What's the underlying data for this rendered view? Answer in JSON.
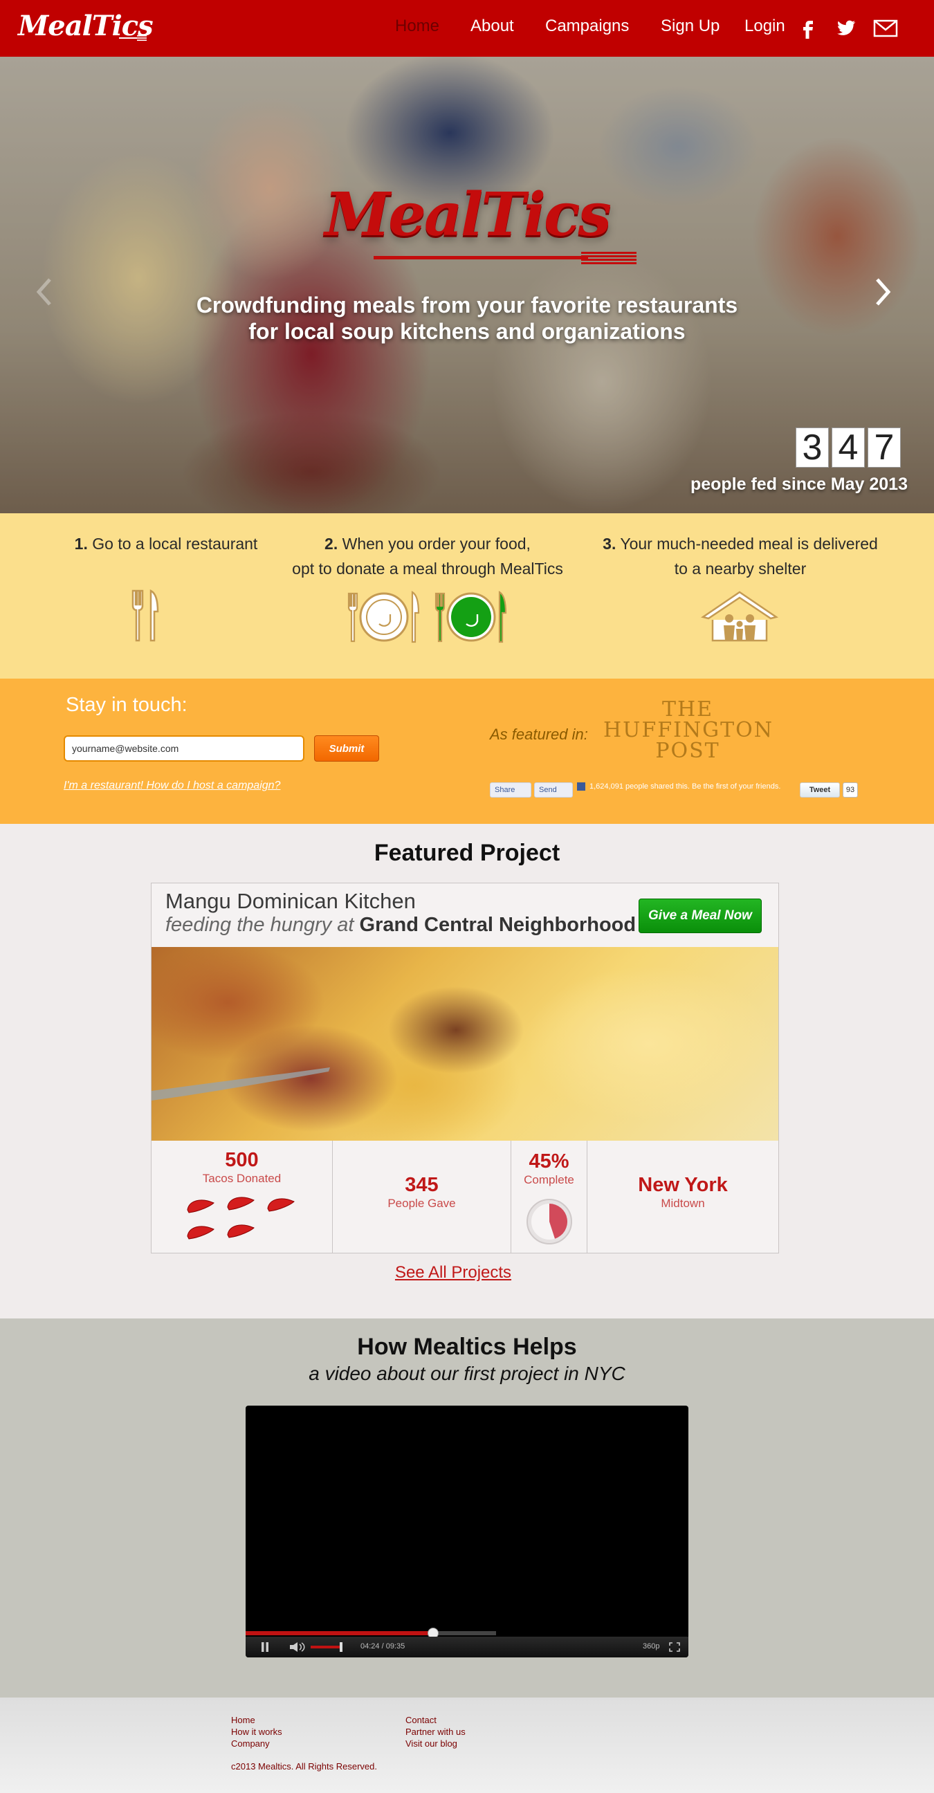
{
  "nav": {
    "logo": "MealTics",
    "links": [
      {
        "label": "Home",
        "active": true
      },
      {
        "label": "About"
      },
      {
        "label": "Campaigns"
      },
      {
        "label": "Sign Up"
      },
      {
        "label": "Login"
      }
    ],
    "social": [
      "facebook-icon",
      "twitter-icon",
      "mail-icon"
    ]
  },
  "hero": {
    "logo": "MealTics",
    "tagline_line1": "Crowdfunding meals from your favorite restaurants",
    "tagline_line2": "for local soup kitchens and organizations",
    "counter_digits": [
      "3",
      "4",
      "7"
    ],
    "fed_text": "people fed since May 2013"
  },
  "steps": [
    {
      "num": "1.",
      "text": "Go to a local restaurant"
    },
    {
      "num": "2.",
      "text_line1": "When you order your food,",
      "text_line2": "opt to donate a meal through MealTics"
    },
    {
      "num": "3.",
      "text_line1": "Your much-needed meal is delivered",
      "text_line2": "to a nearby shelter"
    }
  ],
  "touch": {
    "title": "Stay in touch:",
    "email_value": "yourname@website.com",
    "submit_label": "Submit",
    "restaurant_link": "I'm a restaurant! How do I host a campaign?",
    "featured_in": "As featured in:",
    "huffington_line1": "THE",
    "huffington_line2": "HUFFINGTON",
    "huffington_line3": "POST",
    "fb_share": "Share",
    "fb_send": "Send",
    "fb_count_text": "1,624,091 people shared this. Be the first of your friends.",
    "tweet_label": "Tweet",
    "tweet_count": "93"
  },
  "featured": {
    "section_title": "Featured Project",
    "project_name": "Mangu Dominican Kitchen",
    "sub_prefix": "feeding the hungry at",
    "sub_place": "Grand Central Neighborhood",
    "give_button": "Give a Meal Now",
    "stats": [
      {
        "value": "500",
        "label": "Tacos Donated"
      },
      {
        "value": "345",
        "label": "People Gave"
      },
      {
        "value": "45%",
        "label": "Complete",
        "fraction": 0.45
      },
      {
        "value": "New York",
        "label": "Midtown"
      }
    ],
    "see_all": "See All Projects"
  },
  "helps": {
    "title": "How Mealtics Helps",
    "subtitle": "a video about our first project in NYC",
    "video": {
      "time": "04:24 / 09:35",
      "quality": "360p",
      "progress": 0.46
    }
  },
  "footer": {
    "col1": [
      "Home",
      "How it works",
      "Company"
    ],
    "col2": [
      "Contact",
      "Partner with us",
      "Visit our blog"
    ],
    "copyright": "c2013 Mealtics. All Rights Reserved."
  },
  "colors": {
    "brand_red": "#c00000",
    "steps_bg": "#fbdf8c",
    "touch_bg": "#fdb33e",
    "cta_green": "#0a8f0a",
    "helps_bg": "#c5c5bd"
  }
}
